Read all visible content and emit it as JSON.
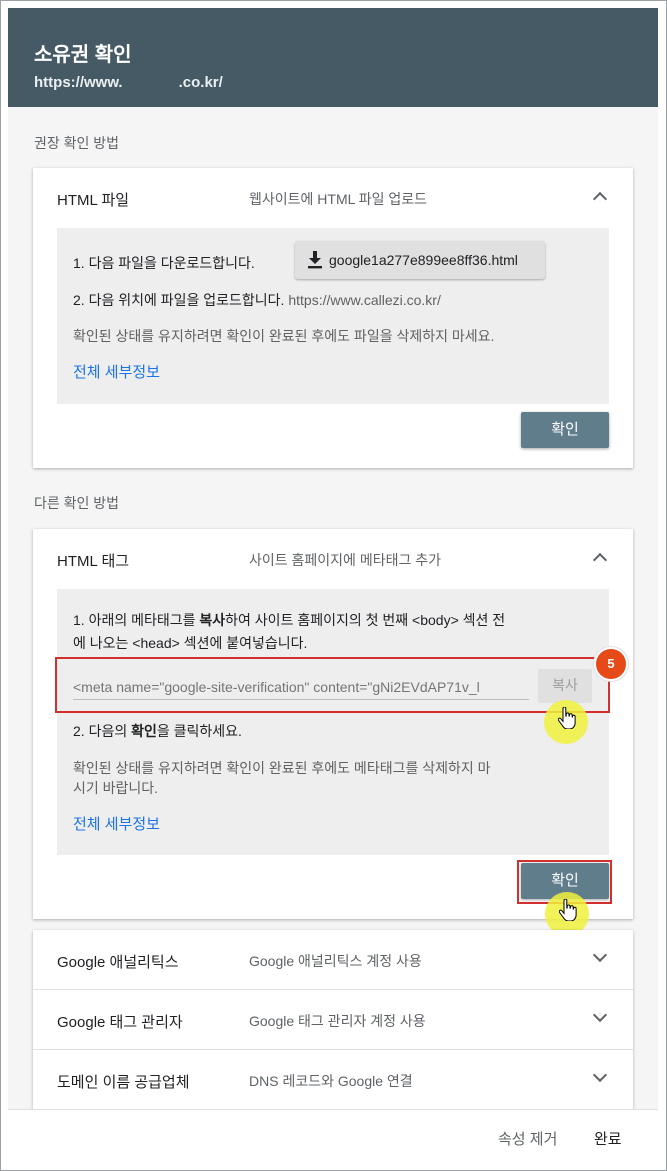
{
  "header": {
    "title": "소유권 확인",
    "url_prefix": "https://www.",
    "url_suffix": ".co.kr/"
  },
  "recommended_label": "권장 확인 방법",
  "html_file": {
    "name": "HTML 파일",
    "desc": "웹사이트에 HTML 파일 업로드",
    "step1": "1. 다음 파일을 다운로드합니다.",
    "download_file": "google1a277e899ee8ff36.html",
    "step2_prefix": "2. 다음 위치에 파일을 업로드합니다.",
    "step2_url": "https://www.callezi.co.kr/",
    "note": "확인된 상태를 유지하려면 확인이 완료된 후에도 파일을 삭제하지 마세요.",
    "details_link": "전체 세부정보",
    "confirm": "확인"
  },
  "other_label": "다른 확인 방법",
  "html_tag": {
    "name": "HTML 태그",
    "desc": "사이트 홈페이지에 메타태그 추가",
    "step1_a": "1. 아래의 메타태그를 ",
    "step1_bold": "복사",
    "step1_b": "하여 사이트 홈페이지의 첫 번째 <body> 섹션 전",
    "step1_line2": "에 나오는 <head> 섹션에 붙여넣습니다.",
    "meta_value": "<meta name=\"google-site-verification\" content=\"gNi2EVdAP71v_l",
    "copy": "복사",
    "step_badge": "5",
    "step2_a": "2. 다음의 ",
    "step2_bold": "확인",
    "step2_b": "을 클릭하세요.",
    "note_line1": "확인된 상태를 유지하려면 확인이 완료된 후에도 메타태그를 삭제하지 마",
    "note_line2": "시기 바랍니다.",
    "details_link": "전체 세부정보",
    "confirm": "확인"
  },
  "collapsed_methods": [
    {
      "name": "Google 애널리틱스",
      "desc": "Google 애널리틱스 계정 사용"
    },
    {
      "name": "Google 태그 관리자",
      "desc": "Google 태그 관리자 계정 사용"
    },
    {
      "name": "도메인 이름 공급업체",
      "desc": "DNS 레코드와 Google 연결"
    }
  ],
  "footer": {
    "remove": "속성 제거",
    "done": "완료"
  },
  "colors": {
    "header_bg": "#455a64",
    "confirm_bg": "#607d8b",
    "link": "#1a73e8",
    "highlight_frame": "#d32f2f",
    "badge": "#e64a19",
    "cursor_highlight": "#f0f03c"
  }
}
